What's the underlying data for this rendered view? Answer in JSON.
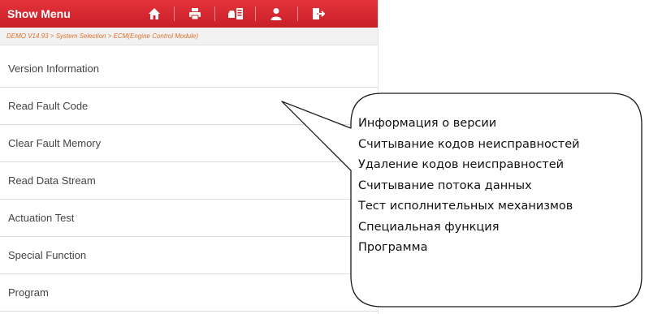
{
  "header": {
    "title": "Show Menu",
    "accent_color": "#d42830",
    "buttons": [
      {
        "name": "home-button",
        "icon": "home-icon"
      },
      {
        "name": "print-button",
        "icon": "printer-icon"
      },
      {
        "name": "vehicle-button",
        "icon": "vehicle-info-icon"
      },
      {
        "name": "user-button",
        "icon": "user-icon"
      },
      {
        "name": "exit-button",
        "icon": "exit-icon"
      }
    ]
  },
  "breadcrumb": {
    "text": "DEMO V14.93 > System Selection > ECM(Engine Control Module)",
    "color": "#e0702a"
  },
  "menu": {
    "items": [
      {
        "label": "Version Information"
      },
      {
        "label": "Read Fault Code"
      },
      {
        "label": "Clear Fault Memory"
      },
      {
        "label": "Read Data Stream"
      },
      {
        "label": "Actuation Test"
      },
      {
        "label": "Special Function"
      },
      {
        "label": "Program"
      }
    ]
  },
  "callout": {
    "lines": [
      "Информация о версии",
      "Считывание кодов неисправностей",
      "Удаление кодов неисправностей",
      "Считывание потока данных",
      "Тест исполнительных механизмов",
      "Специальная функция",
      "Программа"
    ]
  }
}
